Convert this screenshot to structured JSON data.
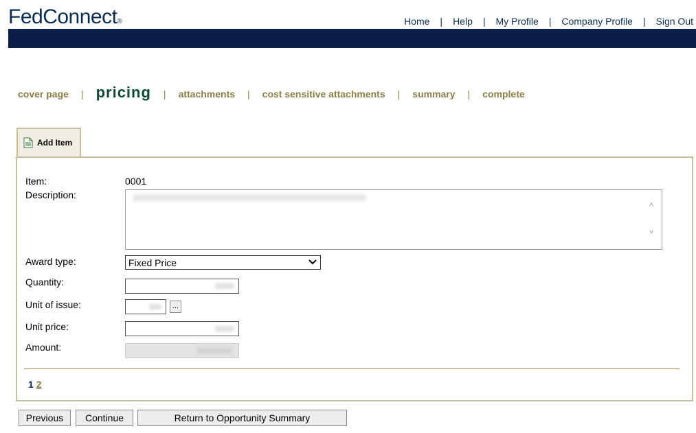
{
  "header": {
    "logo": "FedConnect",
    "logo_mark": "®",
    "nav": [
      "Home",
      "Help",
      "My Profile",
      "Company Profile",
      "Sign Out"
    ],
    "nav_separator": "|"
  },
  "steps": {
    "items": [
      "cover page",
      "pricing",
      "attachments",
      "cost sensitive attachments",
      "summary",
      "complete"
    ],
    "active": "pricing",
    "separator": "|"
  },
  "tab": {
    "label": "Add Item",
    "icon": "document-icon"
  },
  "form": {
    "item_label": "Item:",
    "item_value": "0001",
    "description_label": "Description:",
    "award_type_label": "Award type:",
    "award_type_value": "Fixed Price",
    "quantity_label": "Quantity:",
    "unit_of_issue_label": "Unit of issue:",
    "unit_button_label": "...",
    "unit_price_label": "Unit price:",
    "amount_label": "Amount:"
  },
  "pagination": {
    "current": "1",
    "next": "2"
  },
  "buttons": {
    "previous": "Previous",
    "continue": "Continue",
    "return": "Return to Opportunity Summary"
  },
  "colors": {
    "navy": "#0b1e4a",
    "gold": "#8a7d46",
    "active_step": "#0d4a3a",
    "border": "#c8bf98"
  }
}
